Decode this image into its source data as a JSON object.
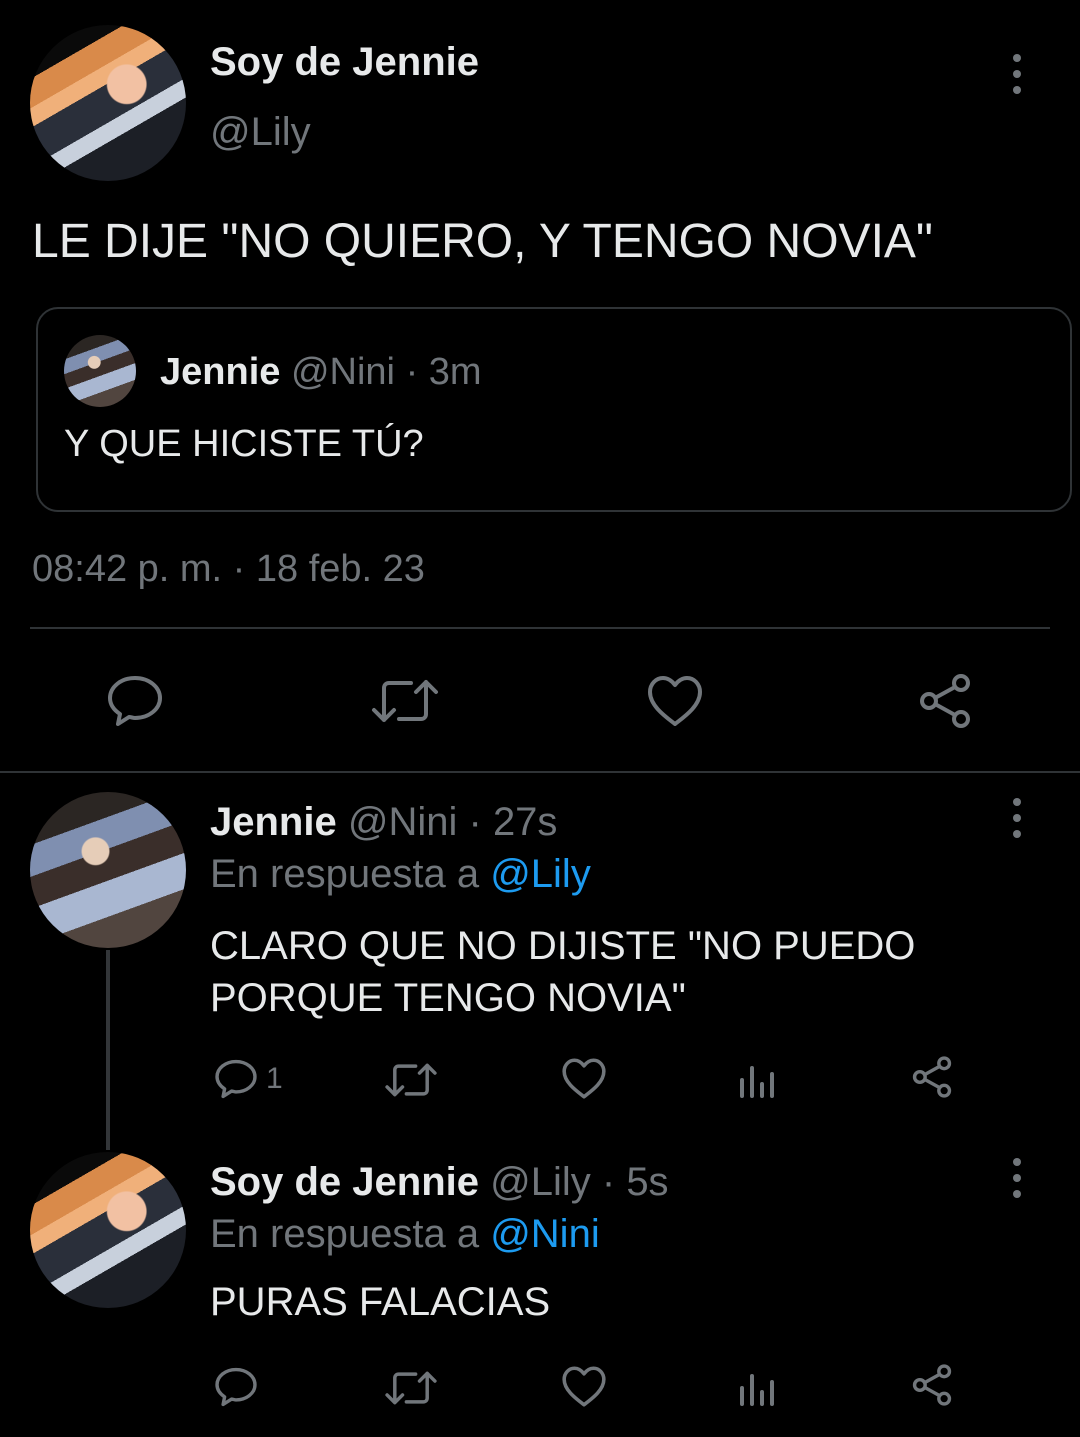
{
  "main_tweet": {
    "display_name": "Soy de Jennie",
    "handle": "@Lily",
    "text": "LE DIJE \"NO QUIERO, Y TENGO NOVIA\"",
    "timestamp": "08:42 p. m. · 18 feb. 23",
    "quoted": {
      "display_name": "Jennie",
      "handle": "@Nini",
      "separator": "·",
      "time": "3m",
      "text": "Y QUE HICISTE TÚ?"
    }
  },
  "replies": [
    {
      "display_name": "Jennie",
      "handle": "@Nini",
      "separator": "·",
      "time": "27s",
      "reply_prefix": "En respuesta a",
      "reply_to": "@Lily",
      "text": "CLARO QUE NO DIJISTE \"NO PUEDO PORQUE TENGO NOVIA\"",
      "reply_count": "1"
    },
    {
      "display_name": "Soy de Jennie",
      "handle": "@Lily",
      "separator": "·",
      "time": "5s",
      "reply_prefix": "En respuesta a",
      "reply_to": "@Nini",
      "text": "PURAS FALACIAS",
      "reply_count": ""
    }
  ],
  "icons": {
    "reply": "reply-icon",
    "retweet": "retweet-icon",
    "like": "like-icon",
    "views": "views-icon",
    "share": "share-icon",
    "more": "more-icon"
  },
  "colors": {
    "background": "#000000",
    "text": "#e7e9ea",
    "muted": "#71767b",
    "link": "#1d9bf0",
    "border": "#2f3336"
  }
}
